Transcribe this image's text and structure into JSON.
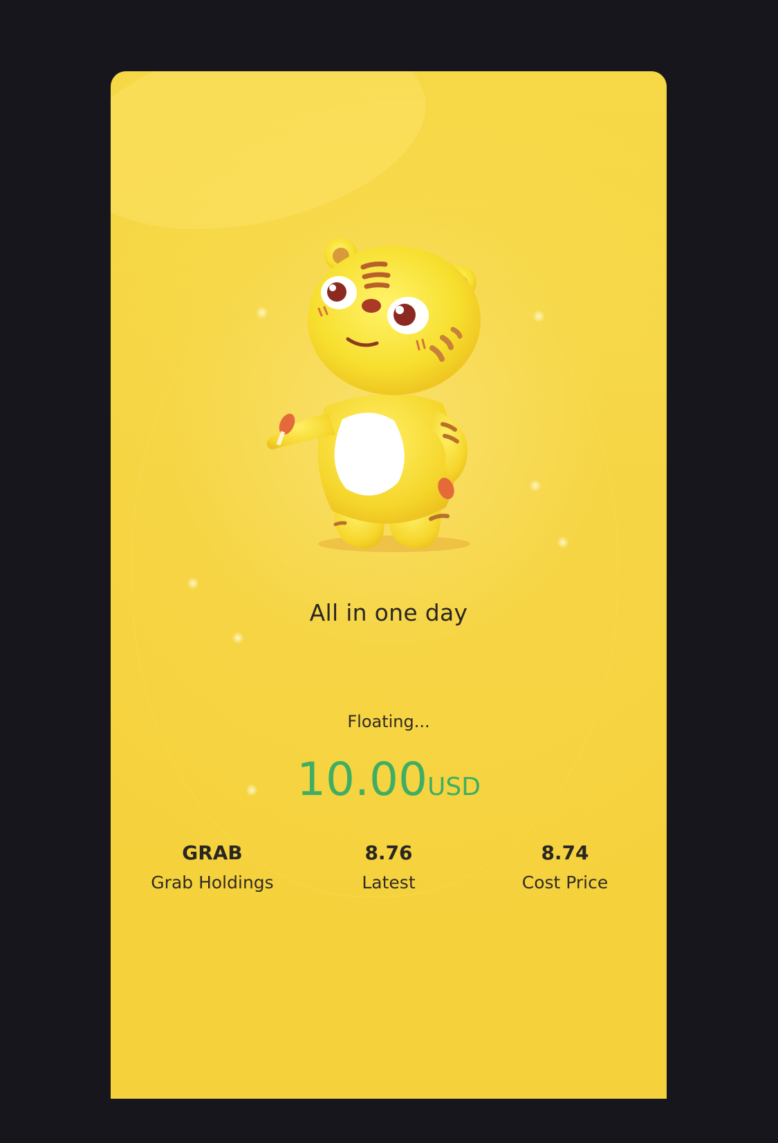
{
  "share_card": {
    "mascot_icon": "tiger-mascot-icon",
    "title": "All in one day",
    "floating_label": "Floating...",
    "amount_value": "10.00",
    "amount_unit": "USD",
    "amount_color": "#3fae62",
    "background_color": "#f6d544",
    "page_background": "#17161c"
  },
  "stats": [
    {
      "value": "GRAB",
      "label": "Grab Holdings"
    },
    {
      "value": "8.76",
      "label": "Latest"
    },
    {
      "value": "8.74",
      "label": "Cost Price"
    }
  ]
}
